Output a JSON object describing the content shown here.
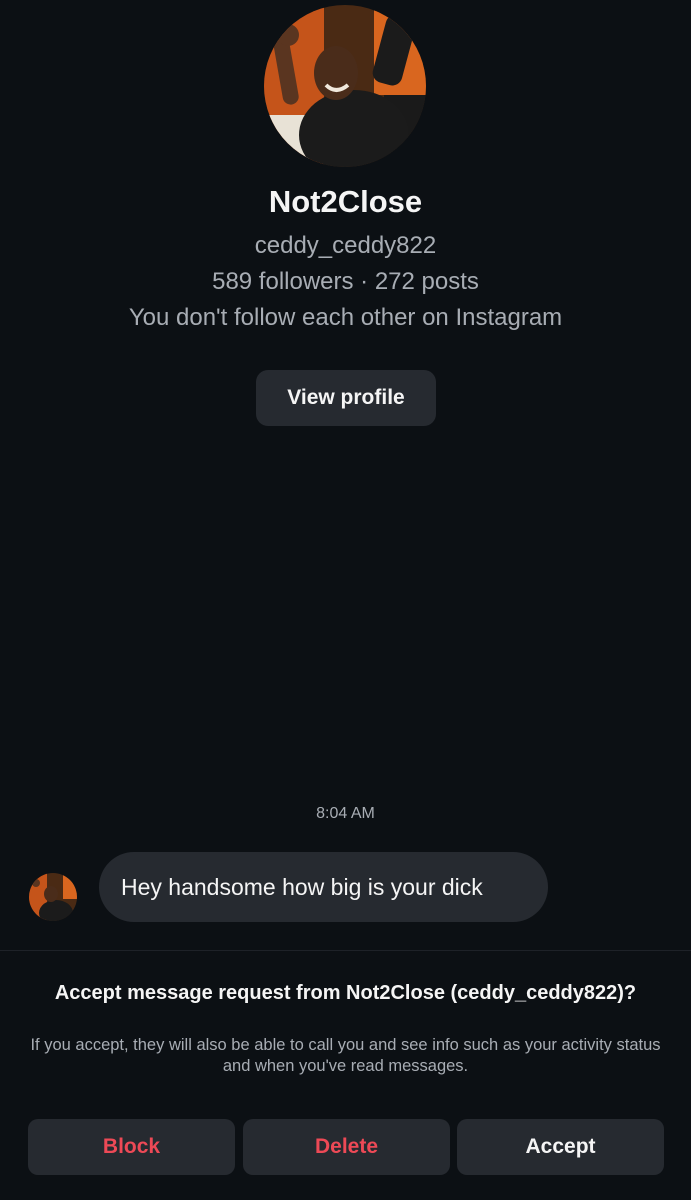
{
  "profile": {
    "display_name": "Not2Close",
    "handle": "ceddy_ceddy822",
    "stats": "589 followers · 272 posts",
    "follow_note": "You don't follow each other on Instagram",
    "view_profile_label": "View profile"
  },
  "thread": {
    "timestamp": "8:04 AM",
    "messages": [
      {
        "text": "Hey handsome how big is your dick"
      }
    ]
  },
  "request": {
    "title": "Accept message request from Not2Close (ceddy_ceddy822)?",
    "body": "If you accept, they will also be able to call you and see info such as your activity status and when you've read messages.",
    "actions": {
      "block": "Block",
      "delete": "Delete",
      "accept": "Accept"
    }
  },
  "colors": {
    "background": "#0c1014",
    "button": "#262a30",
    "danger": "#ed4956",
    "secondary_text": "#a8adb4"
  }
}
